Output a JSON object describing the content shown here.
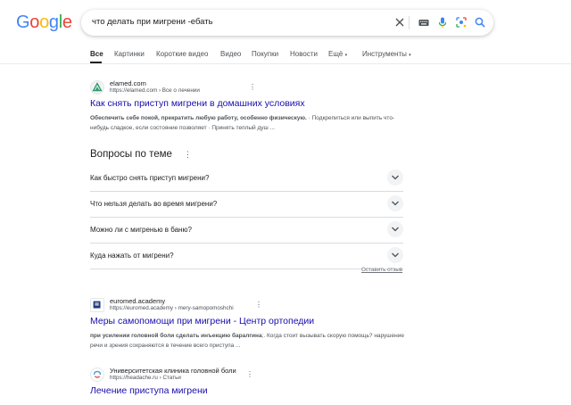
{
  "logo": "Google",
  "search": {
    "query": "что делать при мигрени -ебать"
  },
  "tabs": [
    "Все",
    "Картинки",
    "Короткие видео",
    "Видео",
    "Покупки",
    "Новости",
    "Ещё",
    "Инструменты"
  ],
  "results": [
    {
      "site": "elamed.com",
      "url": "https://elamed.com › Все о лечении",
      "title": "Как снять приступ мигрени в домашних условиях",
      "snippet_bold": "Обеспечить себе покой, прекратить любую работу, особенно физическую.",
      "snippet_rest": " · Подкрепиться или выпить что-нибудь сладкое, если состояние позволяет · Принять теплый душ ..."
    },
    {
      "site": "euromed.academy",
      "url": "https://euromed.academy › mery-samopomoshchi",
      "title": "Меры самопомощи при мигрени - Центр ортопедии",
      "snippet_bold": "при усилении головной боли сделать инъекцию баралгина",
      "snippet_rest": ";. Когда стоит вызывать скорую помощь? нарушение речи и зрения сохраняются в течение всего приступа ..."
    },
    {
      "site": "Университетская клиника головной боли",
      "url": "https://headache.ru › Статьи",
      "title": "Лечение приступа мигрени",
      "snippet_bold": "",
      "snippet_rest": ""
    }
  ],
  "paa": {
    "title": "Вопросы по теме",
    "questions": [
      "Как быстро снять приступ мигрени?",
      "Что нельзя делать во время мигрени?",
      "Можно ли с мигренью в баню?",
      "Куда нажать от мигрени?"
    ],
    "feedback": "Оставить отзыв"
  },
  "colors": {
    "link": "#1a0dab",
    "g_blue": "#4285f4",
    "g_red": "#ea4335",
    "g_yellow": "#fbbc05",
    "g_green": "#34a853"
  }
}
